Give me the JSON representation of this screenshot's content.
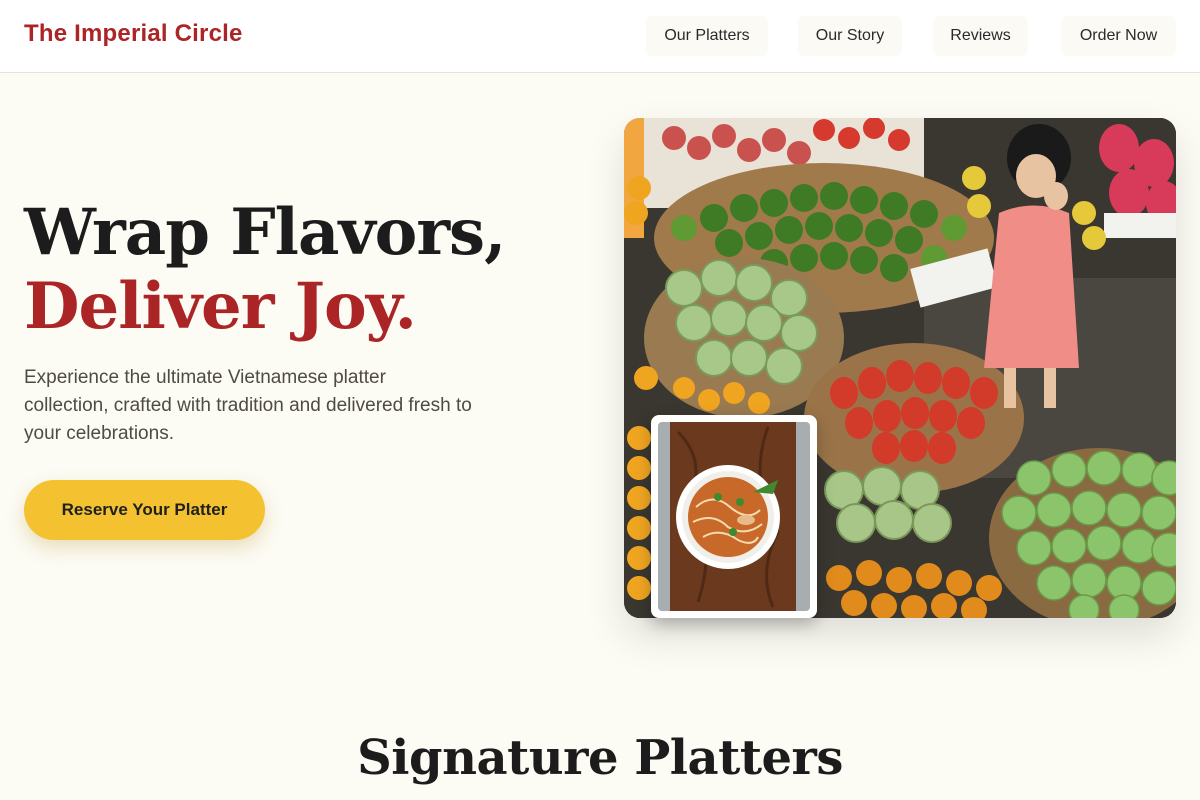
{
  "brand": {
    "name": "The Imperial Circle"
  },
  "nav": {
    "items": [
      {
        "label": "Our Platters"
      },
      {
        "label": "Our Story"
      },
      {
        "label": "Reviews"
      },
      {
        "label": "Order Now"
      }
    ]
  },
  "hero": {
    "title_line1": "Wrap Flavors,",
    "title_line2": "Deliver Joy.",
    "subtitle": "Experience the ultimate Vietnamese platter collection, crafted with tradition and delivered fresh to your celebrations.",
    "cta_label": "Reserve Your Platter"
  },
  "sections": {
    "signature_title": "Signature Platters"
  },
  "colors": {
    "accent": "#ac2526",
    "cta": "#f4c231",
    "background": "#fcfbf4"
  }
}
